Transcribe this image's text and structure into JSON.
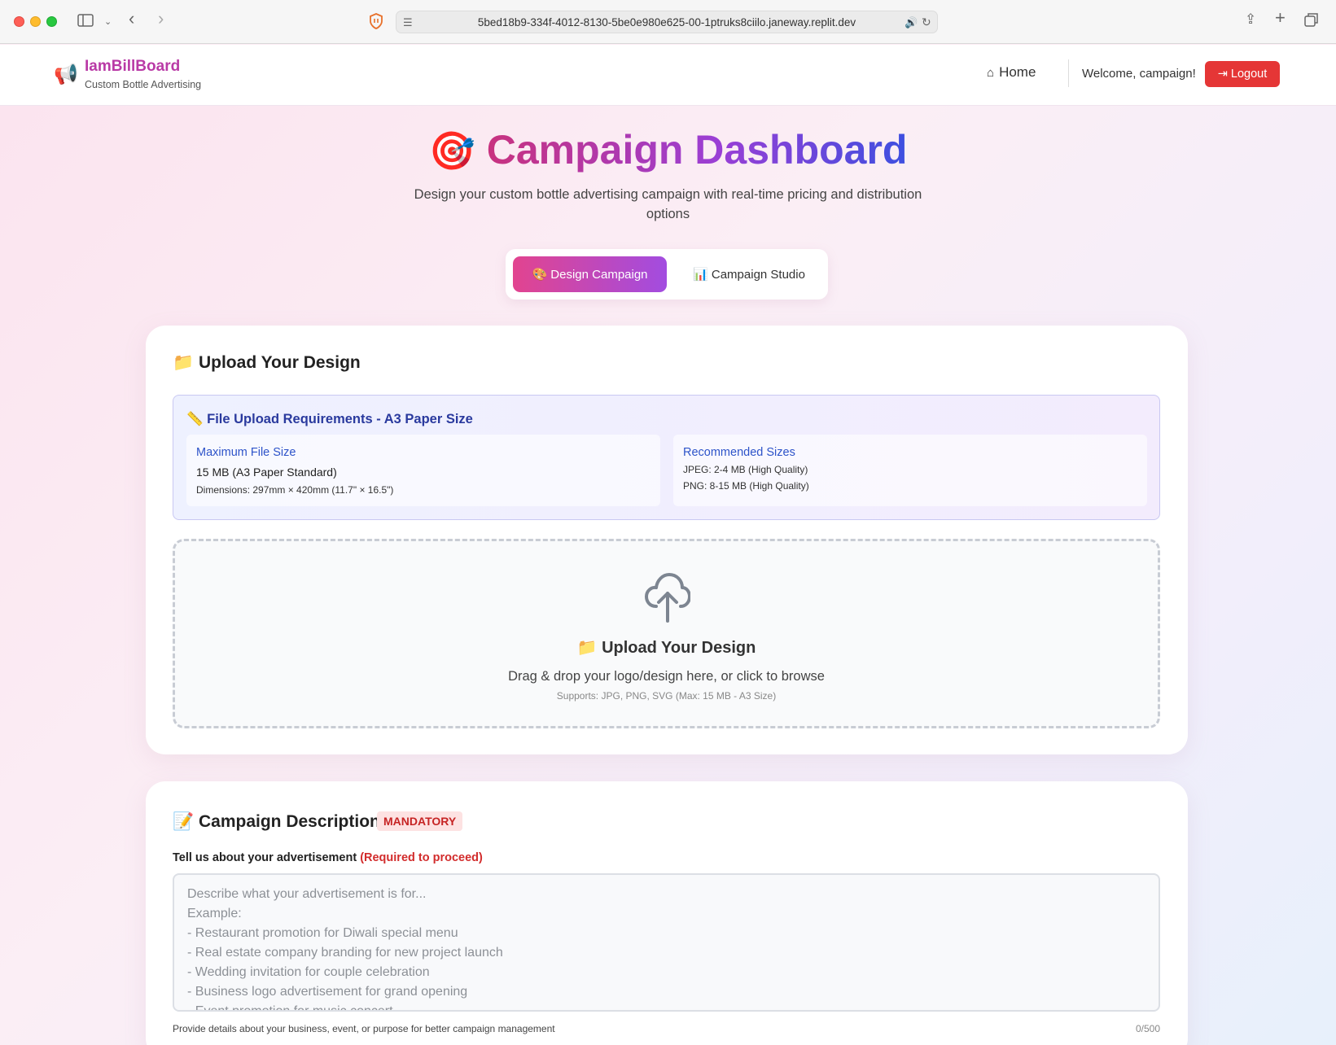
{
  "browser": {
    "url": "5bed18b9-334f-4012-8130-5be0e980e625-00-1ptruks8ciilo.janeway.replit.dev"
  },
  "header": {
    "brand_icon": "📢",
    "brand_name": "IamBillBoard",
    "brand_tagline": "Custom Bottle Advertising",
    "home_label": "Home",
    "welcome_text": "Welcome, campaign!",
    "logout_label": "Logout"
  },
  "hero": {
    "title_emoji": "🎯",
    "title": "Campaign Dashboard",
    "subtitle": "Design your custom bottle advertising campaign with real-time pricing and distribution options"
  },
  "tabs": [
    {
      "label": "🎨 Design Campaign",
      "active": true
    },
    {
      "label": "📊 Campaign Studio",
      "active": false
    }
  ],
  "upload": {
    "heading": "📁 Upload Your Design",
    "requirements": {
      "title": "📏 File Upload Requirements - A3 Paper Size",
      "max_label": "Maximum File Size",
      "max_value": "15 MB (A3 Paper Standard)",
      "dimensions": "Dimensions: 297mm × 420mm (11.7\" × 16.5\")",
      "rec_label": "Recommended Sizes",
      "rec_jpeg": "JPEG: 2-4 MB (High Quality)",
      "rec_png": "PNG: 8-15 MB (High Quality)"
    },
    "dropzone": {
      "title": "📁 Upload Your Design",
      "subtitle": "Drag & drop your logo/design here, or click to browse",
      "supports": "Supports: JPG, PNG, SVG (Max: 15 MB - A3 Size)"
    }
  },
  "description": {
    "heading": "📝 Campaign Description",
    "badge": "MANDATORY",
    "label": "Tell us about your advertisement",
    "label_required": "(Required to proceed)",
    "placeholder": "Describe what your advertisement is for...\nExample:\n- Restaurant promotion for Diwali special menu\n- Real estate company branding for new project launch\n- Wedding invitation for couple celebration\n- Business logo advertisement for grand opening\n- Event promotion for music concert",
    "help_text": "Provide details about your business, event, or purpose for better campaign management",
    "counter": "0/500"
  },
  "colors": {
    "brand": "#b93aa6",
    "logout": "#e53636",
    "tab_gradient_start": "#e2448f",
    "tab_gradient_end": "#a24ce0",
    "mandatory": "#c62424"
  }
}
